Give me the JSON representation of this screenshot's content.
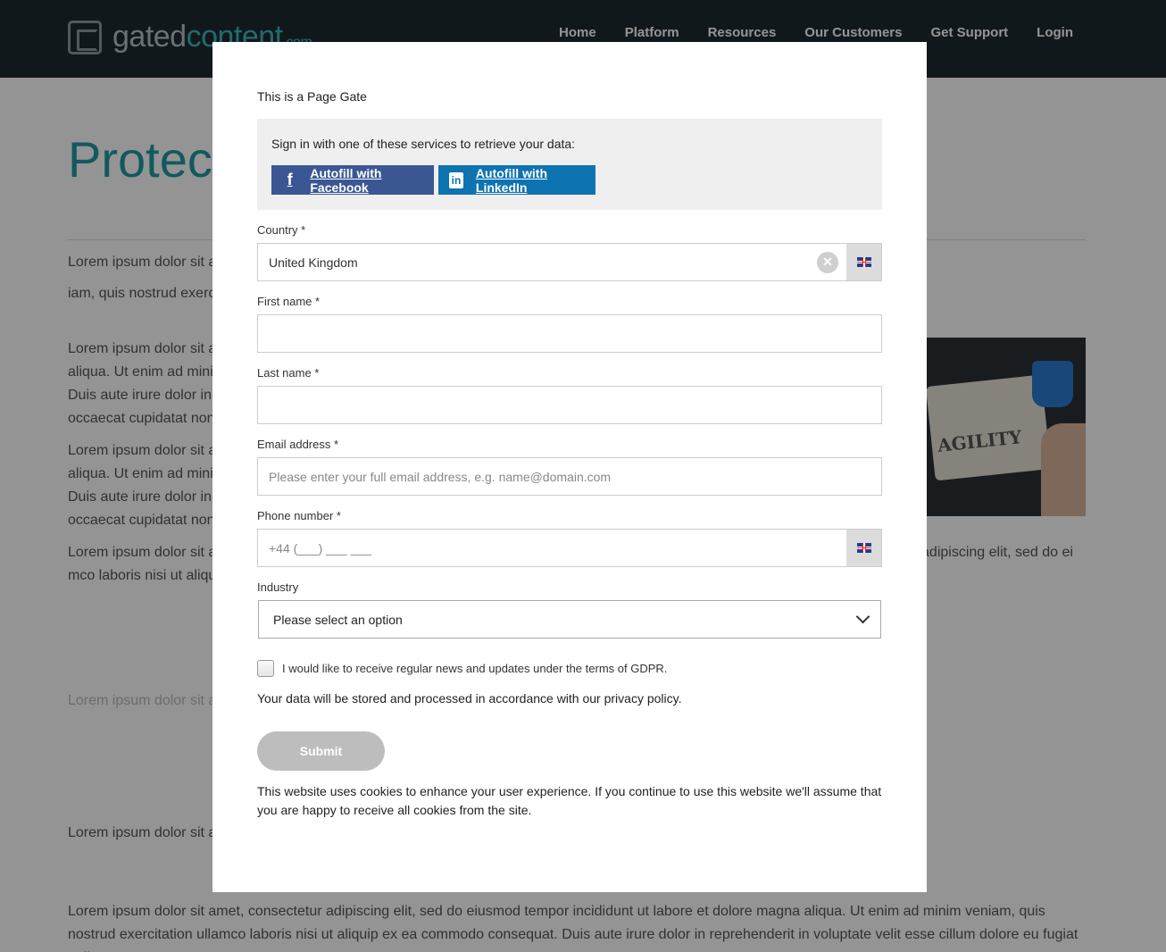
{
  "site": {
    "logo": {
      "name": "gated",
      "accent": "content",
      "tld": ".com"
    },
    "nav": [
      "Home",
      "Platform",
      "Resources",
      "Our Customers",
      "Get Support",
      "Login"
    ],
    "page_title": "Protect",
    "paragraphs": [
      "Lorem ipsum dolor sit a                                                                                                                                                          m ven",
      "iam, quis nostrud exerc                                                                                                                                               elit esse cillum dolore eu fugiat nulla pariatur. Ex",
      "Lorem ipsum dolor sit a aliqua. Ut enim ad minir Duis aute irure dolor in occaecat cupidatat non",
      "Lorem ipsum dolor sit a aliqua. Ut enim ad minir Duis aute irure dolor in occaecat cupidatat non",
      "Lorem ipsum dolor sit a                                                                                                                                                          m veniam, quis nostrud exercitation ullamco lab                                                                                                                     olore eu fugiat nulla pariatur. Excepteur sint                                                                                                                          amet, consectetur adipiscing elit, sed do ei                                                                                                                              mco laboris nisi ut aliquip ex ea commodo conseq                                                                                                                  t occaecat cupidatat non proident, sunt in culpa c",
      "Lorem ipsum dolor sit a                                                                                                                                                          m veniam, quis nostrud exercitation ullamco lab                                                                                                                     olore eu fugiat nulla pariatur. Excepteur sint",
      "Lorem ipsum dolor sit a                                                                                                                                                          m veniam, quis nostrud exercitation ullamco lab                                                                                                                     olore eu fugiat nulla pariatur. Excepteur sint",
      "Lorem ipsum dolor sit amet, consectetur adipiscing elit, sed do eiusmod tempor incididunt ut labore et dolore magna aliqua. Ut enim ad minim veniam, quis nostrud exercitation ullamco laboris nisi ut aliquip ex ea commodo consequat. Duis aute irure dolor in reprehenderit in voluptate velit esse cillum dolore eu fugiat nulla"
    ],
    "image_word": "AGILITY"
  },
  "modal": {
    "title": "This is a Page Gate",
    "sso": {
      "prompt": "Sign in with one of these services to retrieve your data:",
      "facebook_label": "Autofill with Facebook",
      "facebook_icon": "f",
      "linkedin_label": "Autofill with LinkedIn",
      "linkedin_icon": "in"
    },
    "fields": {
      "country": {
        "label": "Country *",
        "value": "United Kingdom",
        "clear_icon": "✕"
      },
      "first_name": {
        "label": "First name *",
        "value": ""
      },
      "last_name": {
        "label": "Last name *",
        "value": ""
      },
      "email": {
        "label": "Email address *",
        "placeholder": "Please enter your full email address, e.g. name@domain.com"
      },
      "phone": {
        "label": "Phone number *",
        "value": "+44 (___) ___ ___"
      },
      "industry": {
        "label": "Industry",
        "selected": "Please select an option"
      }
    },
    "gdpr_label": "I would like to receive regular news and updates under the terms of GDPR.",
    "privacy_text": "Your data will be stored and processed in accordance with our privacy policy.",
    "submit_label": "Submit",
    "cookie_text": "This website uses cookies to enhance your user experience. If you continue to use this website we'll assume that you are happy to receive all cookies from the site."
  }
}
